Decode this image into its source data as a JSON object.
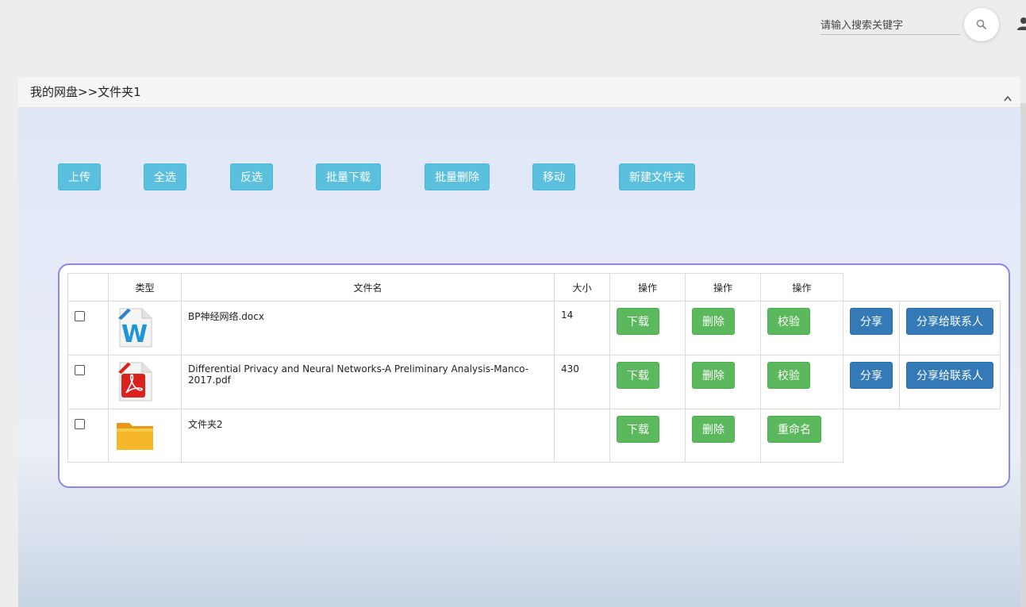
{
  "search": {
    "placeholder": "请输入搜索关键字",
    "icon": "search-icon"
  },
  "user": {
    "icon": "user-icon"
  },
  "breadcrumb": {
    "text": "我的网盘>>文件夹1"
  },
  "toolbar": {
    "upload": "上传",
    "select_all": "全选",
    "invert_select": "反选",
    "batch_download": "批量下载",
    "batch_delete": "批量删除",
    "move": "移动",
    "new_folder": "新建文件夹"
  },
  "table": {
    "headers": [
      "类型",
      "文件名",
      "大小",
      "操作",
      "操作",
      "操作"
    ],
    "rows": [
      {
        "icon": "word-doc-icon",
        "name": "BP神经网络.docx",
        "size": "14",
        "actions": [
          "下载",
          "删除",
          "校验"
        ],
        "share": "分享",
        "share_contact": "分享给联系人"
      },
      {
        "icon": "pdf-doc-icon",
        "name": "Differential Privacy and Neural Networks-A Preliminary Analysis-Manco-2017.pdf",
        "size": "430",
        "actions": [
          "下载",
          "删除",
          "校验"
        ],
        "share": "分享",
        "share_contact": "分享给联系人"
      },
      {
        "icon": "folder-icon",
        "name": "文件夹2",
        "size": "",
        "actions": [
          "下载",
          "删除",
          "重命名"
        ]
      }
    ]
  },
  "colors": {
    "toolbar_button": "#5bc0de",
    "green_button": "#5cb85c",
    "blue_button": "#337ab7",
    "table_border": "#8a86ea"
  }
}
